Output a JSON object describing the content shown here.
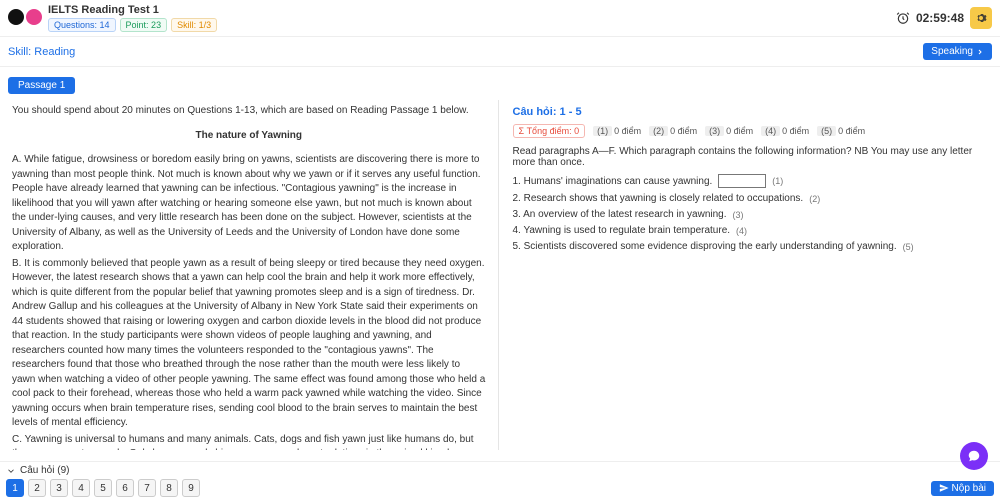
{
  "header": {
    "title": "IELTS Reading Test 1",
    "pills": {
      "questions": "Questions: 14",
      "points": "Point: 23",
      "skill": "Skill: 1/3"
    },
    "timer": "02:59:48"
  },
  "subheader": {
    "skill": "Skill: Reading",
    "speaking_btn": "Speaking"
  },
  "tabs": {
    "passage1": "Passage 1"
  },
  "passage": {
    "instruction": "You should spend about 20 minutes on Questions 1-13, which are based on Reading Passage 1 below.",
    "heading": "The nature of Yawning",
    "paraA": "A. While fatigue, drowsiness or boredom easily bring on yawns, scientists are discovering there is more to yawning than most people think. Not much is known about why we yawn or if it serves any useful function. People have already learned that yawning can be infectious. \"Contagious yawning\" is the increase in likelihood that you will yawn after watching or hearing someone else yawn, but not much is known about the under-lying causes, and very little research has been done on the subject. However, scientists at the University of Albany, as well as the University of Leeds and the University of London have done some exploration.",
    "paraB": "B. It is commonly believed that people yawn as a result of being sleepy or tired because they need oxygen. However, the latest research shows that a yawn can help cool the brain and help it work more effectively, which is quite different from the popular belief that yawning promotes sleep and is a sign of tiredness. Dr. Andrew Gallup and his colleagues at the University of Albany in New York State said their experiments on 44 students showed that raising or lowering oxygen and carbon dioxide levels in the blood did not produce that reaction. In the study participants were shown videos of people laughing and yawning, and researchers counted how many times the volunteers responded to the \"contagious yawns\". The researchers found that those who breathed through the nose rather than the mouth were less likely to yawn when watching a video of other people yawning. The same effect was found among those who held a cool pack to their forehead, whereas those who held a warm pack yawned while watching the video. Since yawning occurs when brain temperature rises, sending cool blood to the brain serves to maintain the best levels of mental efficiency.",
    "paraC": "C. Yawning is universal to humans and many animals. Cats, dogs and fish yawn just like humans do, but they yawn spontaneously. Only humans and chimpanzees, our closest relatives in the animal kingdom, have shown definite contagious yawning. Though much of yawning is due to suggestibility, sometimes people do not need to"
  },
  "questions": {
    "header": "Câu hỏi: 1 - 5",
    "total_label": "Σ Tổng điểm: 0",
    "scores": [
      {
        "n": "(1)",
        "v": "0 điểm"
      },
      {
        "n": "(2)",
        "v": "0 điểm"
      },
      {
        "n": "(3)",
        "v": "0 điểm"
      },
      {
        "n": "(4)",
        "v": "0 điểm"
      },
      {
        "n": "(5)",
        "v": "0 điểm"
      }
    ],
    "instruction": "Read paragraphs A—F. Which paragraph contains the following information? NB You may use any letter more than once.",
    "items": [
      {
        "text": "1. Humans' imaginations can cause yawning.",
        "num": "(1)",
        "boxed": true
      },
      {
        "text": "2. Research shows that yawning is closely related to occupations.",
        "num": "(2)"
      },
      {
        "text": "3. An overview of the latest research in yawning.",
        "num": "(3)"
      },
      {
        "text": "4. Yawning is used to regulate brain temperature.",
        "num": "(4)"
      },
      {
        "text": "5. Scientists discovered some evidence disproving the early understanding of yawning.",
        "num": "(5)"
      }
    ]
  },
  "bottom": {
    "toggle": "Câu hỏi (9)",
    "nums": [
      "1",
      "2",
      "3",
      "4",
      "5",
      "6",
      "7",
      "8",
      "9"
    ],
    "submit": "Nộp bài"
  }
}
